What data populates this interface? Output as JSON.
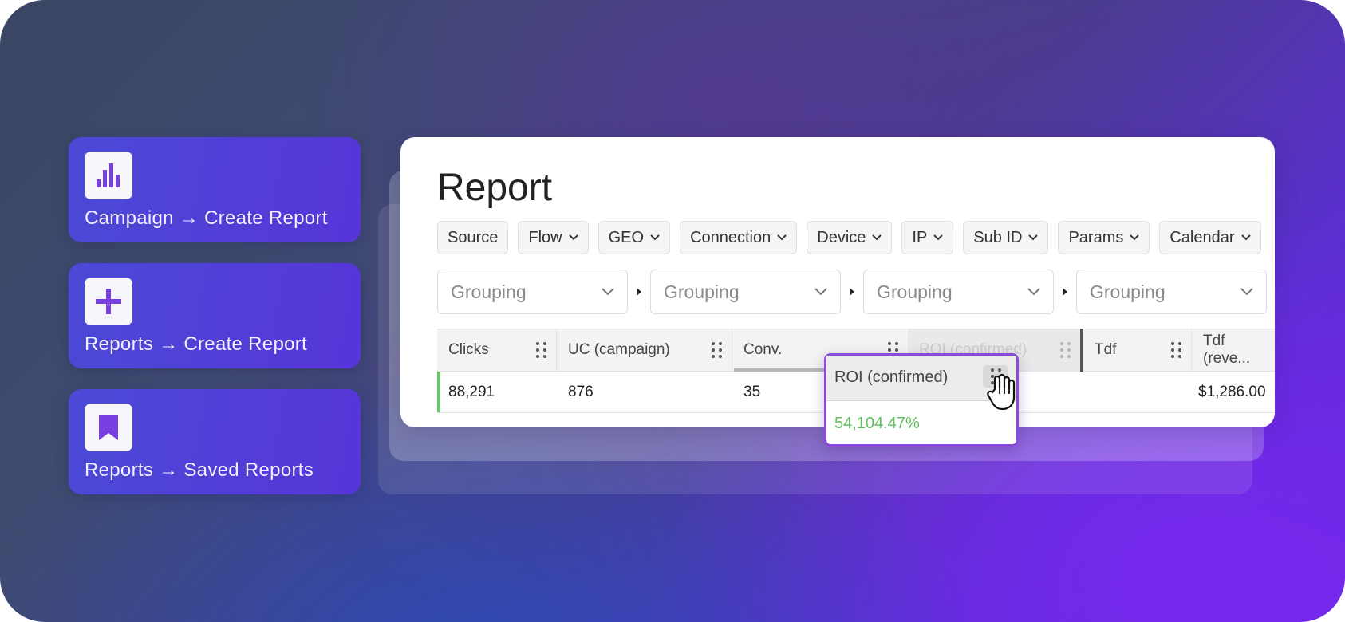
{
  "nav": [
    {
      "label": "Campaign → Create Report",
      "icon": "bar-chart-icon"
    },
    {
      "label": "Reports → Create Report",
      "icon": "plus-icon"
    },
    {
      "label": "Reports → Saved Reports",
      "icon": "bookmark-icon"
    }
  ],
  "report": {
    "title": "Report",
    "filters": [
      "Source",
      "Flow",
      "GEO",
      "Connection",
      "Device",
      "IP",
      "Sub ID",
      "Params",
      "Calendar"
    ],
    "groupings": [
      "Grouping",
      "Grouping",
      "Grouping",
      "Grouping"
    ],
    "columns": [
      "Clicks",
      "UC (campaign)",
      "Conv.",
      "ROI (confirmed)",
      "Tdf",
      "Tdf (reve..."
    ],
    "row": {
      "clicks": "88,291",
      "uc": "876",
      "conv": "35",
      "tdf_revenue": "$1,286.00"
    },
    "dragged": {
      "label": "ROI (confirmed)",
      "value": "54,104.47%"
    }
  },
  "colors": {
    "accent": "#5a3bd9",
    "icon": "#7a3fe0",
    "positive": "#5fbd5c",
    "drag_border": "#8a4bd8"
  }
}
